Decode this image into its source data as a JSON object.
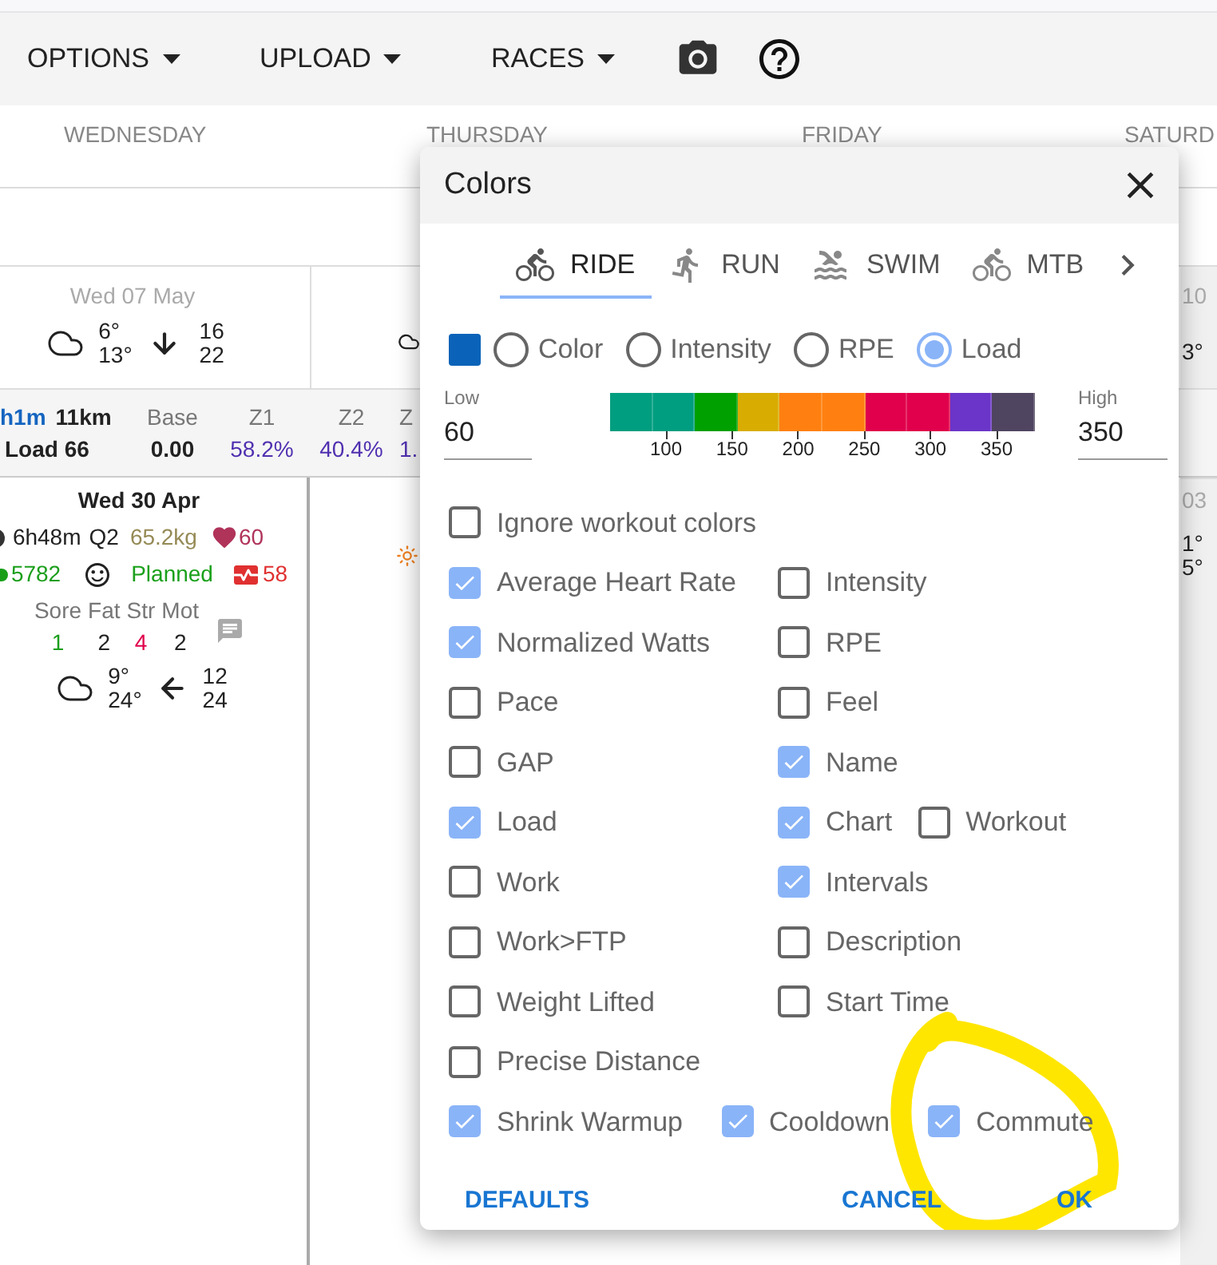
{
  "toolbar": {
    "menus": [
      "OPTIONS",
      "UPLOAD",
      "RACES"
    ]
  },
  "calendar": {
    "day_headers": [
      "WEDNESDAY",
      "THURSDAY",
      "FRIDAY",
      "SATURD"
    ],
    "week_1": {
      "date": "Wed 07 May",
      "temp_low": "6°",
      "temp_high": "13°",
      "wind_1": "16",
      "wind_2": "22",
      "right_date": "10",
      "right_temp": "3°"
    },
    "summary": {
      "time": "h1m",
      "distance": "11km",
      "load": "Load 66",
      "columns": [
        {
          "label": "Base",
          "value": "0.00",
          "kind": "plain"
        },
        {
          "label": "Z1",
          "value": "58.2%",
          "kind": "zone"
        },
        {
          "label": "Z2",
          "value": "40.4%",
          "kind": "zone"
        },
        {
          "label": "Z",
          "value": "1.",
          "kind": "zone"
        }
      ]
    },
    "week_2": {
      "date": "Wed 30 Apr",
      "duration": "6h48m",
      "quality": "Q2",
      "weight": "65.2kg",
      "resting_hr": "60",
      "steps": "5782",
      "status": "Planned",
      "hrv": "58",
      "wellness": [
        {
          "label": "Sore",
          "value": "1",
          "color": "#1a9e1a"
        },
        {
          "label": "Fat",
          "value": "2",
          "color": "#222222"
        },
        {
          "label": "Str",
          "value": "4",
          "color": "#e0004c"
        },
        {
          "label": "Mot",
          "value": "2",
          "color": "#222222"
        }
      ],
      "temp_low": "9°",
      "temp_high": "24°",
      "wind_1": "12",
      "wind_2": "24",
      "right_date": "03",
      "right_temp_1": "1°",
      "right_temp_2": "5°"
    }
  },
  "dialog": {
    "title": "Colors",
    "tabs": [
      {
        "label": "RIDE",
        "kind": "bike",
        "selected": true
      },
      {
        "label": "RUN",
        "kind": "run",
        "selected": false
      },
      {
        "label": "SWIM",
        "kind": "swim",
        "selected": false
      },
      {
        "label": "MTB",
        "kind": "bike",
        "selected": false
      }
    ],
    "swatch": {
      "color": "#0a63b8"
    },
    "modes": [
      {
        "label": "Color",
        "selected": false
      },
      {
        "label": "Intensity",
        "selected": false
      },
      {
        "label": "RPE",
        "selected": false
      },
      {
        "label": "Load",
        "selected": true
      }
    ],
    "low": {
      "label": "Low",
      "value": "60"
    },
    "high": {
      "label": "High",
      "value": "350"
    },
    "scale": {
      "segments": [
        {
          "color": "#009e80"
        },
        {
          "color": "#009e80"
        },
        {
          "color": "#00a000"
        },
        {
          "color": "#d8ac00"
        },
        {
          "color": "#ff8010"
        },
        {
          "color": "#ff8010"
        },
        {
          "color": "#e0004c"
        },
        {
          "color": "#e0004c"
        },
        {
          "color": "#6a35c8"
        },
        {
          "color": "#504560"
        }
      ],
      "ticks": [
        "100",
        "150",
        "200",
        "250",
        "300",
        "350"
      ]
    },
    "option_rows": [
      {
        "kind": "pair",
        "left": [
          {
            "label": "Ignore workout colors",
            "checked": false
          }
        ],
        "right": []
      },
      {
        "kind": "pair",
        "left": [
          {
            "label": "Average Heart Rate",
            "checked": true
          }
        ],
        "right": [
          {
            "label": "Intensity",
            "checked": false
          }
        ]
      },
      {
        "kind": "pair",
        "left": [
          {
            "label": "Normalized Watts",
            "checked": true
          }
        ],
        "right": [
          {
            "label": "RPE",
            "checked": false
          }
        ]
      },
      {
        "kind": "pair",
        "left": [
          {
            "label": "Pace",
            "checked": false
          }
        ],
        "right": [
          {
            "label": "Feel",
            "checked": false
          }
        ]
      },
      {
        "kind": "pair",
        "left": [
          {
            "label": "GAP",
            "checked": false
          }
        ],
        "right": [
          {
            "label": "Name",
            "checked": true
          }
        ]
      },
      {
        "kind": "pair",
        "left": [
          {
            "label": "Load",
            "checked": true
          }
        ],
        "right": [
          {
            "label": "Chart",
            "checked": true
          },
          {
            "label": "Workout",
            "checked": false
          }
        ]
      },
      {
        "kind": "pair",
        "left": [
          {
            "label": "Work",
            "checked": false
          }
        ],
        "right": [
          {
            "label": "Intervals",
            "checked": true
          }
        ]
      },
      {
        "kind": "pair",
        "left": [
          {
            "label": "Work>FTP",
            "checked": false
          }
        ],
        "right": [
          {
            "label": "Description",
            "checked": false
          }
        ]
      },
      {
        "kind": "pair",
        "left": [
          {
            "label": "Weight Lifted",
            "checked": false
          }
        ],
        "right": [
          {
            "label": "Start Time",
            "checked": false
          }
        ]
      },
      {
        "kind": "pair",
        "left": [
          {
            "label": "Precise Distance",
            "checked": false
          }
        ],
        "right": []
      },
      {
        "kind": "inline",
        "left": [
          {
            "label": "Shrink Warmup",
            "checked": true
          },
          {
            "label": "Cooldown",
            "checked": true
          },
          {
            "label": "Commute",
            "checked": true
          }
        ],
        "right": []
      }
    ],
    "buttons": {
      "left": "DEFAULTS",
      "cancel": "CANCEL",
      "ok": "OK"
    }
  }
}
